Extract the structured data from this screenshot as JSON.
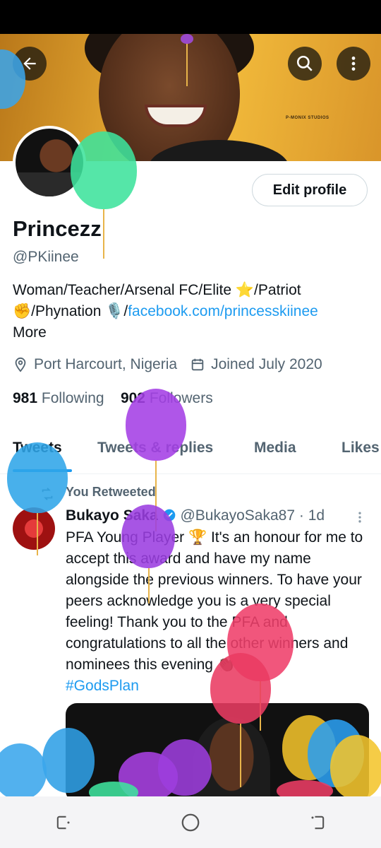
{
  "header": {
    "back_icon": "arrow-left-icon",
    "search_icon": "search-icon",
    "more_icon": "more-vertical-icon",
    "banner_watermark": "P-MONIX STUDIOS"
  },
  "profile": {
    "edit_button": "Edit profile",
    "name": "Princezz",
    "handle": "@PKiinee",
    "bio_line1": "Woman/Teacher/Arsenal FC/Elite ⭐/Patriot",
    "bio_line2_prefix": "✊/Phynation 🎙️/",
    "bio_link": "facebook.com/princesskiinee",
    "bio_more": "More",
    "location": "Port Harcourt, Nigeria",
    "joined": "Joined July 2020",
    "following_count": "981",
    "following_label": "Following",
    "followers_count": "902",
    "followers_label": "Followers"
  },
  "tabs": [
    "Tweets",
    "Tweets & replies",
    "Media",
    "Likes"
  ],
  "tweet": {
    "retweet_label": "You Retweeted",
    "author_name": "Bukayo Saka",
    "author_handle": "@BukayoSaka87",
    "time": "· 1d",
    "text": "PFA Young Player 🏆 It's an honour for me to accept this award and have my name alongside the previous winners. To have your peers acknowledge you is a very special feeling! Thank you to the PFA and congratulations to all the other winners and nominees this evening 👏🏿",
    "hashtag": "#GodsPlan"
  },
  "colors": {
    "accent": "#1d9bf0",
    "text": "#0f1419",
    "secondary": "#536471"
  }
}
